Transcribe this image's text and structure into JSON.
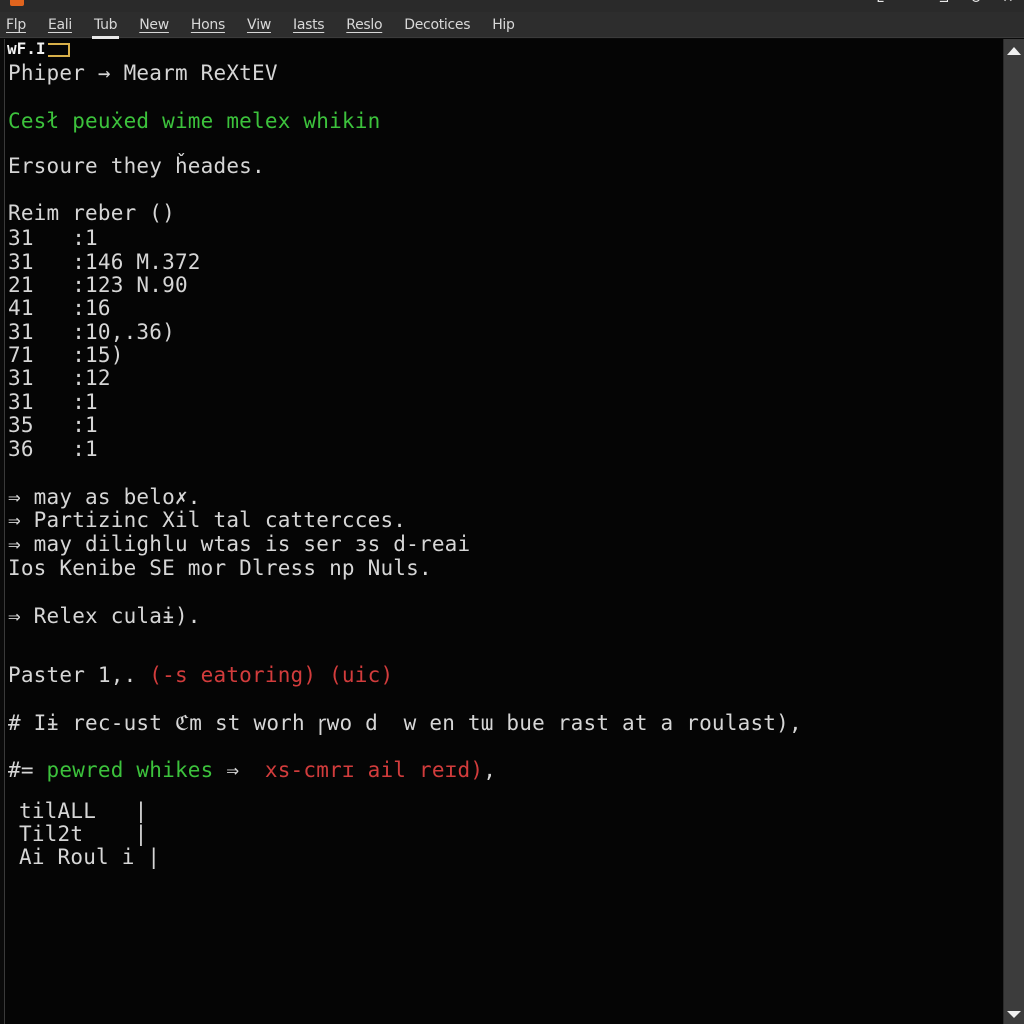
{
  "window": {
    "controls": [
      "minimize",
      "restore",
      "power",
      "close"
    ]
  },
  "menu": {
    "items": [
      {
        "label": "Flp",
        "active": false
      },
      {
        "label": "Eali",
        "active": false
      },
      {
        "label": "Tub",
        "active": true
      },
      {
        "label": "New",
        "active": false
      },
      {
        "label": "Hons",
        "active": false
      },
      {
        "label": "Vi̇w",
        "active": false
      },
      {
        "label": "Iasts",
        "active": false
      },
      {
        "label": "Reslo",
        "active": false
      },
      {
        "label": "Decotices",
        "active": false
      },
      {
        "label": "Hip",
        "active": false
      }
    ]
  },
  "terminal": {
    "prompt_head": "wF.I",
    "lines": {
      "l1": "Phiper → Mearm ReXtEV",
      "l2": "Cesł peuẋed wime melex whikin",
      "l3": "Ersoure they ȟeades.",
      "l4": "Reim reber ()",
      "l5": "31   :1",
      "l6": "31   :146 M.372",
      "l7": "21   :123 N.90",
      "l8": "41   :16",
      "l9": "31   :10,.36)",
      "l10": "71   :15)",
      "l11": "31   :12",
      "l12": "31   :1",
      "l13": "35   :1",
      "l14": "36   :1",
      "l15": "⇒ may as belo✗.",
      "l16": "⇒ Partizinc Xil tal cattercces.",
      "l17": "⇒ may dilighlu wtas is ser ɜs d-reai",
      "l18": "Ios Kenibe SE mor Dlress np Nuls.",
      "l19": "⇒ Relex culaɨ).",
      "l20_a": "Paster 1,. ",
      "l20_b": "(-s eatoring) (uic)",
      "l21": "# Iɨ rec-ust ℭm st worh ꞅwo d  w en tɯ bue rast at a roulast),",
      "l22_a": "#= ",
      "l22_b": "pewred whikes",
      "l22_c": " ⇒  ",
      "l22_d": "xs-cmrɪ ail reɪd)",
      "l22_e": ",",
      "l23": "tilALL   |",
      "l24": "Til2t    |",
      "l25": "Ai Roul i |"
    }
  },
  "colors": {
    "green": "#3cc23c",
    "red": "#d23c3c",
    "accent_orange": "#e0641e",
    "cursor_yellow": "#d8b04a"
  }
}
